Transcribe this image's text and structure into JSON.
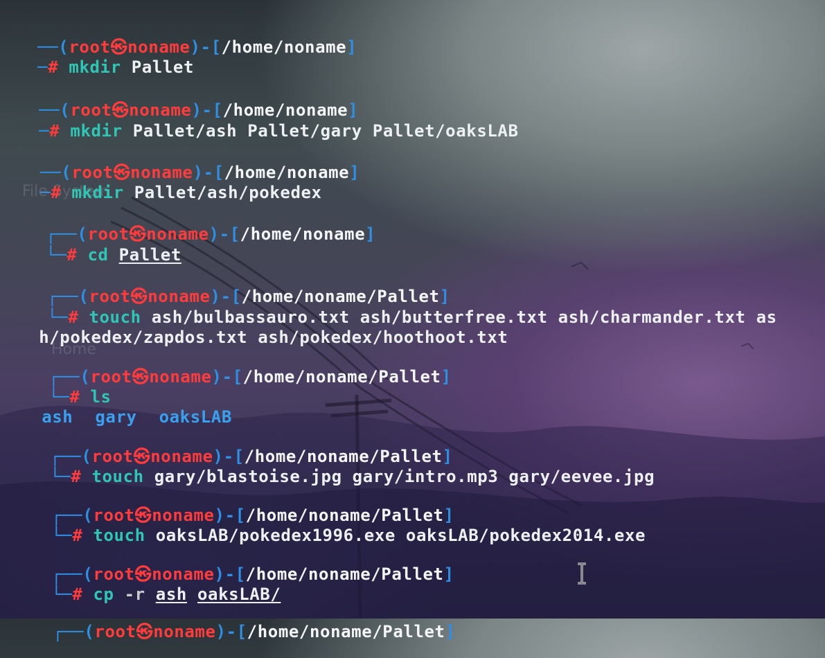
{
  "prompt": {
    "user": "root",
    "at_symbol": "㉿",
    "host": "noname",
    "hash": "#"
  },
  "desktop_labels": {
    "file_system": "File System",
    "home": "Home"
  },
  "blocks": [
    {
      "path": "/home/noname",
      "cmd": "mkdir",
      "args": "Pallet"
    },
    {
      "path": "/home/noname",
      "cmd": "mkdir",
      "args": "Pallet/ash Pallet/gary Pallet/oaksLAB"
    },
    {
      "path": "/home/noname",
      "cmd": "mkdir",
      "args": "Pallet/ash/pokedex"
    },
    {
      "path": "/home/noname",
      "cmd": "cd",
      "args": "Pallet"
    },
    {
      "path": "/home/noname/Pallet",
      "cmd": "touch",
      "args": "ash/bulbassauro.txt ash/butterfree.txt ash/charmander.txt as",
      "wrap": "h/pokedex/zapdos.txt ash/pokedex/hoothoot.txt"
    },
    {
      "path": "/home/noname/Pallet",
      "cmd": "ls",
      "args": "",
      "output": [
        "ash",
        "gary",
        "oaksLAB"
      ]
    },
    {
      "path": "/home/noname/Pallet",
      "cmd": "touch",
      "args": "gary/blastoise.jpg gary/intro.mp3 gary/eevee.jpg"
    },
    {
      "path": "/home/noname/Pallet",
      "cmd": "touch",
      "args": "oaksLAB/pokedex1996.exe oaksLAB/pokedex2014.exe"
    },
    {
      "path": "/home/noname/Pallet",
      "cmd": "cp",
      "opt": "-r",
      "arg1": "ash",
      "arg2": "oaksLAB/"
    },
    {
      "path": "/home/noname/Pallet"
    }
  ]
}
